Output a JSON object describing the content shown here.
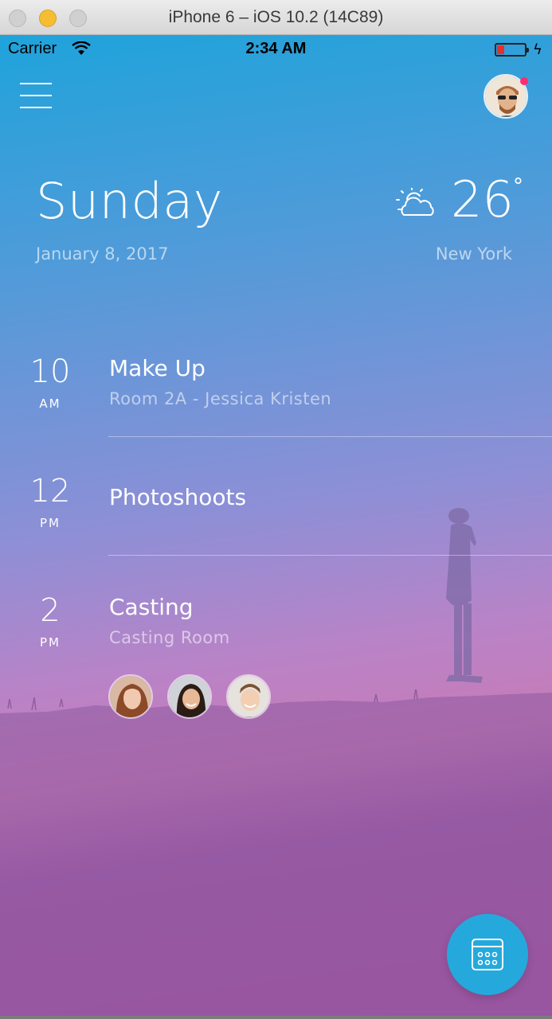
{
  "window": {
    "title": "iPhone 6 – iOS 10.2 (14C89)"
  },
  "status_bar": {
    "carrier": "Carrier",
    "time": "2:34 AM",
    "battery_level": 0.25
  },
  "header": {
    "day": "Sunday",
    "date": "January 8, 2017",
    "weather": {
      "temperature": "26",
      "degree_symbol": "°",
      "city": "New York",
      "icon": "partly-cloudy-icon"
    }
  },
  "events": [
    {
      "hour": "10",
      "ampm": "AM",
      "title": "Make Up",
      "subtitle": "Room 2A - Jessica Kristen"
    },
    {
      "hour": "12",
      "ampm": "PM",
      "title": "Photoshoots",
      "subtitle": ""
    },
    {
      "hour": "2",
      "ampm": "PM",
      "title": "Casting",
      "subtitle": "Casting Room"
    }
  ],
  "icons": {
    "menu": "hamburger-menu-icon",
    "profile": "profile-avatar",
    "fab": "calendar-icon"
  },
  "colors": {
    "fab": "#25a9dc",
    "notification_dot": "#ff2d6f",
    "gradient_top": "#1fa3db",
    "gradient_bottom": "#a5509f"
  }
}
